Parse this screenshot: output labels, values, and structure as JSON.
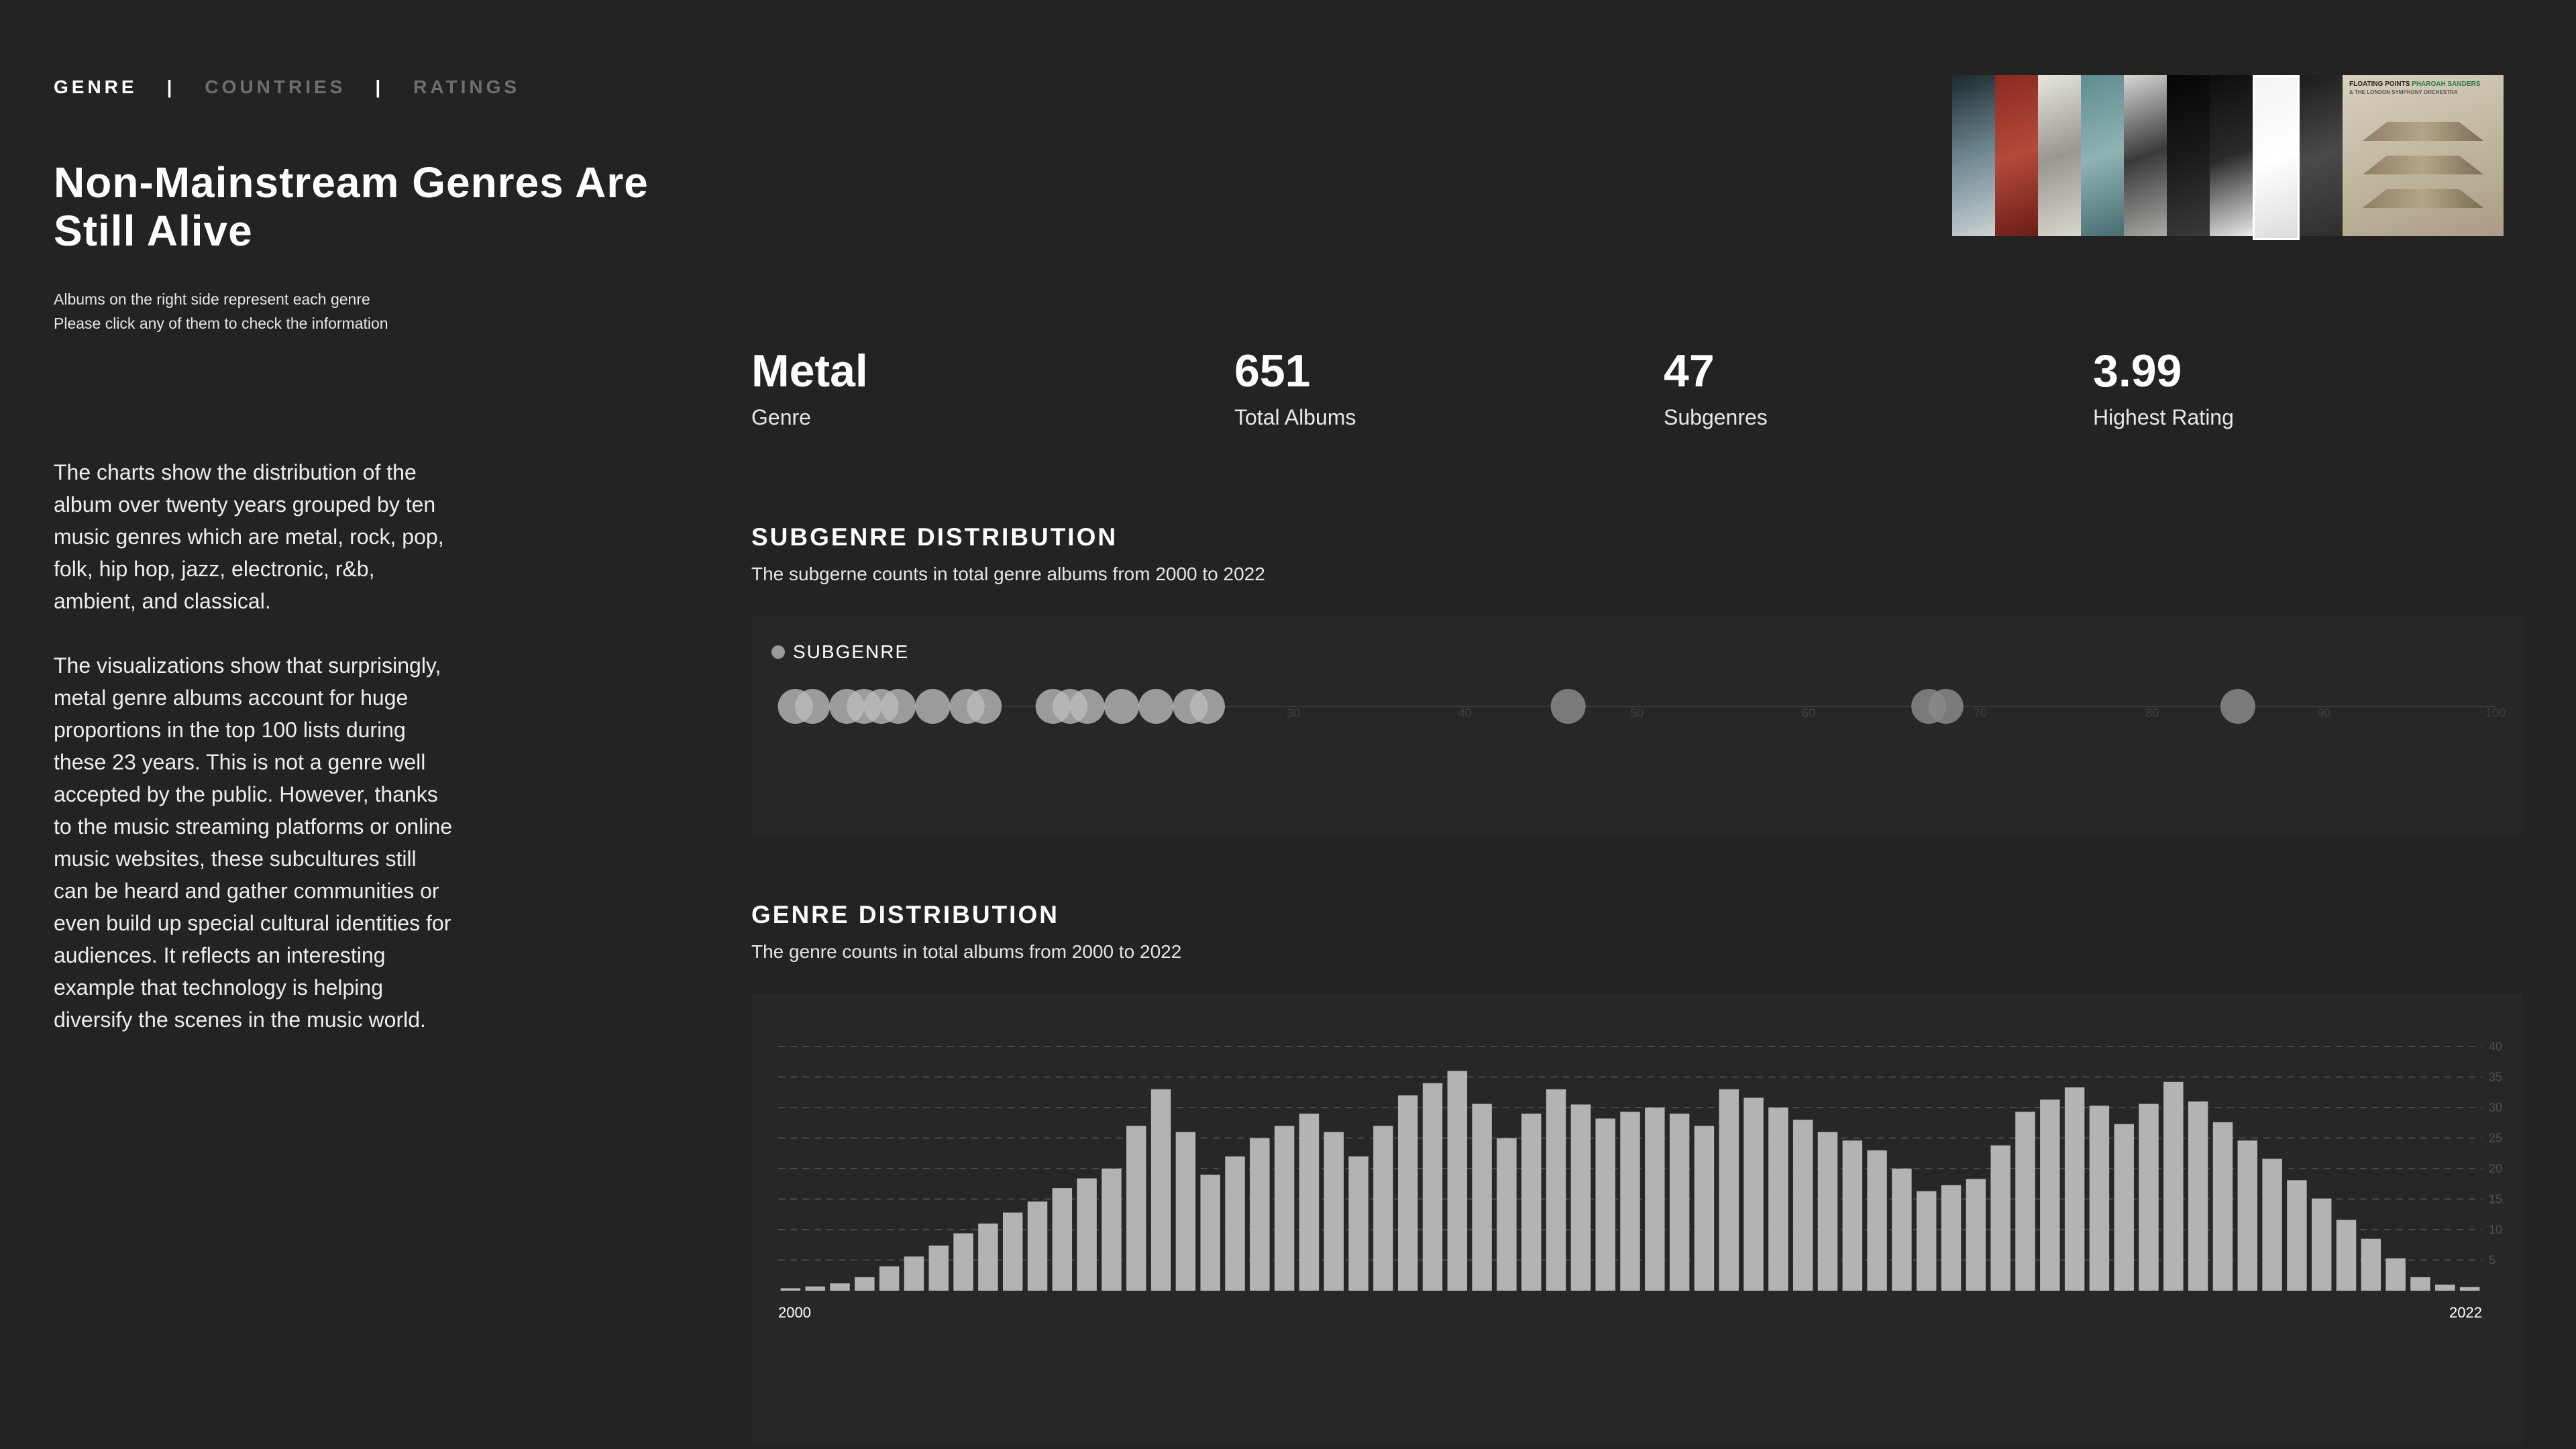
{
  "nav": {
    "tabs": [
      "GENRE",
      "COUNTRIES",
      "RATINGS"
    ],
    "separator": "|"
  },
  "title": "Non-Mainstream Genres Are Still Alive",
  "hint": {
    "line1": "Albums on the right side represent each genre",
    "line2": "Please click any of them to check the information"
  },
  "description": {
    "p1": "The charts show the distribution of the album over twenty years grouped by ten music genres which are metal, rock, pop, folk, hip hop, jazz, electronic, r&b, ambient, and classical.",
    "p2": "The visualizations show that surprisingly, metal genre albums account for huge proportions in the top 100 lists during these 23 years. This is not a genre well accepted by the public. However, thanks to the music streaming platforms or online music websites, these subcultures still can be heard and gather communities or even build up special cultural identities for audiences. It reflects an interesting example that technology is helping diversify the scenes in the music world."
  },
  "covers": [
    {
      "name": "metal",
      "colors": [
        "#1b2a2e",
        "#6f8890",
        "#c9d3d4"
      ]
    },
    {
      "name": "rock",
      "colors": [
        "#8a2a22",
        "#b44a3a",
        "#6a1c18"
      ]
    },
    {
      "name": "pop",
      "colors": [
        "#e8e6e0",
        "#9a9690",
        "#d9d6cf"
      ]
    },
    {
      "name": "folk",
      "colors": [
        "#5f8c8f",
        "#8fb3b3",
        "#466d70"
      ]
    },
    {
      "name": "hip-hop",
      "colors": [
        "#d6d6d3",
        "#3a3a3a",
        "#a8a8a4"
      ]
    },
    {
      "name": "jazz",
      "colors": [
        "#050505",
        "#1a1a1a",
        "#3a3a3a"
      ]
    },
    {
      "name": "electronic",
      "colors": [
        "#0d0d0d",
        "#2b2b2b",
        "#e9e9e9"
      ]
    },
    {
      "name": "rnb",
      "colors": [
        "#f4f4f2",
        "#ffffff",
        "#dcdcdc"
      ]
    },
    {
      "name": "ambient",
      "colors": [
        "#1c1c1c",
        "#4a4a4a",
        "#2e2e2e"
      ]
    },
    {
      "name": "classical",
      "colors": [
        "#d8d1bf",
        "#c2b8a0",
        "#a89d84"
      ],
      "text1": "FLOATING POINTS",
      "text2": "PHAROAH SANDERS",
      "text3": "& THE LONDON SYMPHONY ORCHESTRA"
    }
  ],
  "stats": {
    "genre": {
      "value": "Metal",
      "label": "Genre"
    },
    "total": {
      "value": "651",
      "label": "Total Albums"
    },
    "subgenres": {
      "value": "47",
      "label": "Subgenres"
    },
    "rating": {
      "value": "3.99",
      "label": "Highest Rating"
    }
  },
  "subgenre_section": {
    "title": "SUBGENRE DISTRIBUTION",
    "subtitle": "The subgerne counts in total genre albums from 2000 to 2022",
    "legend": "SUBGENRE"
  },
  "genre_section": {
    "title": "GENRE DISTRIBUTION",
    "subtitle": "The genre counts in total albums from 2000 to 2022"
  },
  "chart_data": [
    {
      "type": "scatter",
      "name": "subgenre-strip",
      "xlim": [
        0,
        100
      ],
      "ticks": [
        30,
        40,
        50,
        60,
        70,
        80,
        90,
        100
      ],
      "values": [
        1,
        2,
        4,
        5,
        6,
        7,
        9,
        11,
        12,
        16,
        17,
        18,
        20,
        22,
        24,
        25,
        46,
        67,
        68,
        85
      ],
      "color": "#bdbdbd"
    },
    {
      "type": "bar",
      "name": "genre-distribution",
      "x_start_label": "2000",
      "x_end_label": "2022",
      "ylim": [
        0,
        40
      ],
      "yticks": [
        5,
        10,
        15,
        20,
        25,
        30,
        35,
        40
      ],
      "values": [
        0.4,
        0.7,
        1.2,
        2.2,
        4,
        5.6,
        7.4,
        9.4,
        11,
        12.8,
        14.6,
        16.8,
        18.4,
        20,
        27,
        33,
        26,
        19,
        22,
        25,
        27,
        29,
        26,
        22,
        27,
        32,
        34,
        36,
        30.6,
        25,
        29,
        33,
        30.5,
        28.2,
        29.3,
        30,
        29,
        27,
        33,
        31.6,
        30,
        28,
        26,
        24.6,
        23,
        20,
        16.3,
        17.3,
        18.3,
        23.8,
        29.3,
        31.3,
        33.3,
        30.3,
        27.3,
        30.6,
        34.2,
        31,
        27.6,
        24.6,
        21.6,
        18.1,
        15.1,
        11.6,
        8.5,
        5.3,
        2.2,
        1.0,
        0.6
      ],
      "color": "#b3b3b3",
      "grid": true
    }
  ]
}
